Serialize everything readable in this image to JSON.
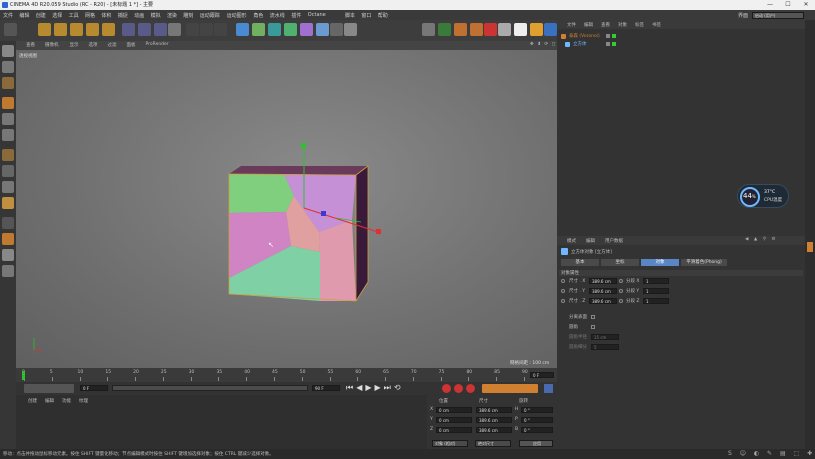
{
  "window": {
    "title": "CINEMA 4D R20.059 Studio (RC - R20) - [未标题 1 *] - 主要"
  },
  "menubar": {
    "items": [
      "文件",
      "编辑",
      "创建",
      "选择",
      "工具",
      "网格",
      "体积",
      "捕捉",
      "动画",
      "模拟",
      "渲染",
      "雕刻",
      "运动跟踪",
      "运动图形",
      "角色",
      "流水线",
      "插件",
      "Octane",
      "脚本",
      "窗口",
      "帮助"
    ],
    "layout_label": "界面",
    "layout_value": "启动 (用户)"
  },
  "viewport": {
    "menu": [
      "查看",
      "摄像机",
      "显示",
      "选项",
      "过滤",
      "面板",
      "ProRender"
    ],
    "camera_label": "透视视图",
    "grid_spacing": "网格间距 : 100 cm"
  },
  "timeline": {
    "ticks": [
      "0",
      "5",
      "10",
      "15",
      "20",
      "25",
      "30",
      "35",
      "40",
      "45",
      "50",
      "55",
      "60",
      "65",
      "70",
      "75",
      "80",
      "85",
      "90"
    ],
    "current_frame": "0 F"
  },
  "transport": {
    "start_field": "0 F",
    "end_field": "90 F",
    "right_end": "90 F"
  },
  "materials": {
    "menu": [
      "创建",
      "编辑",
      "功能",
      "纹理"
    ]
  },
  "coords": {
    "headers": [
      "位置",
      "尺寸",
      "旋转"
    ],
    "rows": [
      {
        "axis": "X",
        "pos": "0 cm",
        "size": "389.6 cm",
        "rot_axis": "H",
        "rot": "0 °"
      },
      {
        "axis": "Y",
        "pos": "0 cm",
        "size": "389.6 cm",
        "rot_axis": "P",
        "rot": "0 °"
      },
      {
        "axis": "Z",
        "pos": "0 cm",
        "size": "389.6 cm",
        "rot_axis": "B",
        "rot": "0 °"
      }
    ],
    "mode_select": "对象 (相对)",
    "size_select": "绝对尺寸",
    "apply_button": "应用"
  },
  "object_manager": {
    "menu": [
      "文件",
      "编辑",
      "查看",
      "对象",
      "标签",
      "书签"
    ],
    "objects": [
      {
        "name": "泰森 (Voronoi)",
        "color": "#d08030"
      },
      {
        "name": "立方体",
        "color": "#6fb8ff"
      }
    ]
  },
  "hud": {
    "cpu_percent": "44",
    "cpu_unit": "%",
    "temperature": "37°C",
    "temp_label": "CPU温度"
  },
  "attributes": {
    "menu": [
      "模式",
      "编辑",
      "用户数据"
    ],
    "object_title": "立方体对象 [立方体]",
    "tabs": [
      "基本",
      "坐标",
      "对象",
      "平滑着色(Phong)"
    ],
    "active_tab": 2,
    "section": "对象属性",
    "size_rows": [
      {
        "label": "尺寸 . X",
        "value": "389.6 cm",
        "seg_label": "分段 X",
        "seg": "1"
      },
      {
        "label": "尺寸 . Y",
        "value": "389.6 cm",
        "seg_label": "分段 Y",
        "seg": "1"
      },
      {
        "label": "尺寸 . Z",
        "value": "389.6 cm",
        "seg_label": "分段 Z",
        "seg": "1"
      }
    ],
    "separate_surfaces": "分离表面",
    "fillet": "圆角",
    "fillet_radius_label": "圆角半径",
    "fillet_radius": "15 cm",
    "fillet_subdiv_label": "圆角细分",
    "fillet_subdiv": "5"
  },
  "statusbar": {
    "text": "移动：点击并拖动鼠标移动元素。按住 SHIFT 键量化移动；节点编辑模式时按住 SHIFT 键增加选择对象；按住 CTRL 键减少选择对象。"
  },
  "colors": {
    "accent": "#5a86c6",
    "axis_y": "#2ec02e",
    "axis_x": "#e03030",
    "cube_right": "#3a1a3a"
  }
}
